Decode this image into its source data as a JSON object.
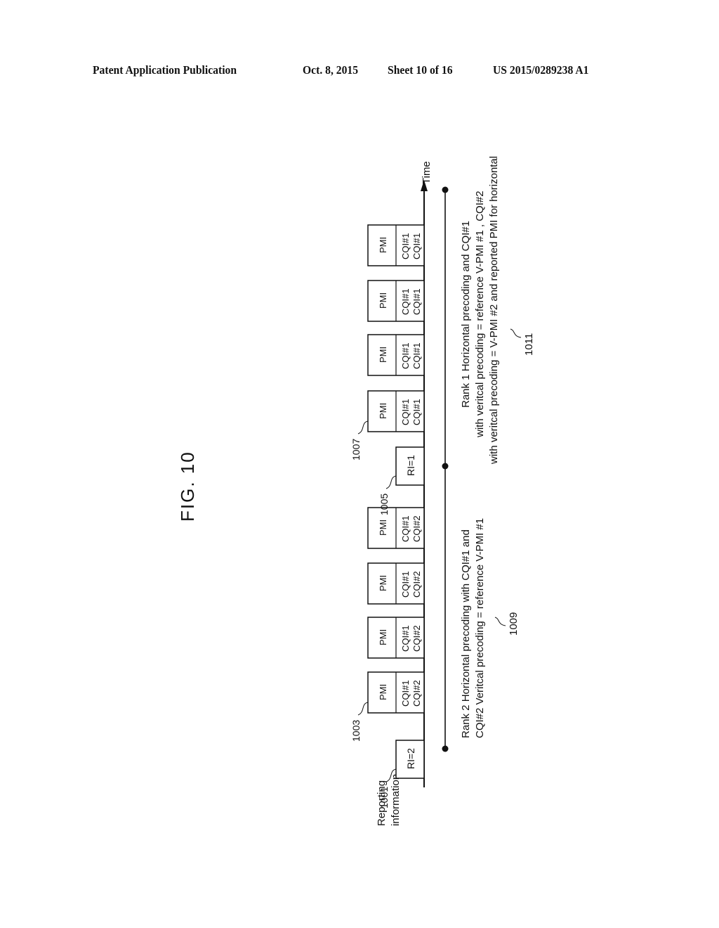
{
  "header": {
    "publication": "Patent Application Publication",
    "date": "Oct. 8, 2015",
    "sheet": "Sheet 10 of 16",
    "number": "US 2015/0289238 A1"
  },
  "figure": {
    "title": "FIG. 10",
    "axis_label": "Time",
    "row_label_line1": "Reporting",
    "row_label_line2": "information",
    "reports": [
      {
        "type": "RI",
        "text": "RI=2",
        "ref": "1001"
      },
      {
        "type": "PMI",
        "text": "PMI",
        "cqi1": "CQI#1",
        "cqi2": "CQI#2",
        "ref": "1003"
      },
      {
        "type": "PMI",
        "text": "PMI",
        "cqi1": "CQI#1",
        "cqi2": "CQI#2"
      },
      {
        "type": "PMI",
        "text": "PMI",
        "cqi1": "CQI#1",
        "cqi2": "CQI#2"
      },
      {
        "type": "PMI",
        "text": "PMI",
        "cqi1": "CQI#1",
        "cqi2": "CQI#2"
      },
      {
        "type": "RI",
        "text": "RI=1",
        "ref": "1005"
      },
      {
        "type": "PMI",
        "text": "PMI",
        "cqi1": "CQI#1",
        "cqi2": "CQI#1",
        "ref": "1007"
      },
      {
        "type": "PMI",
        "text": "PMI",
        "cqi1": "CQI#1",
        "cqi2": "CQI#1"
      },
      {
        "type": "PMI",
        "text": "PMI",
        "cqi1": "CQI#1",
        "cqi2": "CQI#1"
      },
      {
        "type": "PMI",
        "text": "PMI",
        "cqi1": "CQI#1",
        "cqi2": "CQI#1"
      }
    ],
    "period1": {
      "ref": "1009",
      "line1": "Rank 2 Horizontal precoding with CQI#1 and",
      "line2": "CQI#2 Veritcal precoding = reference V-PMI #1"
    },
    "period2": {
      "ref": "1011",
      "line1": "Rank 1 Horizontal precoding and CQI#1",
      "line2": "with veritcal precoding = reference V-PMI #1 , CQI#2",
      "line3": "with veritcal precoding = V-PMI #2 and reported PMI for horizontal"
    }
  }
}
